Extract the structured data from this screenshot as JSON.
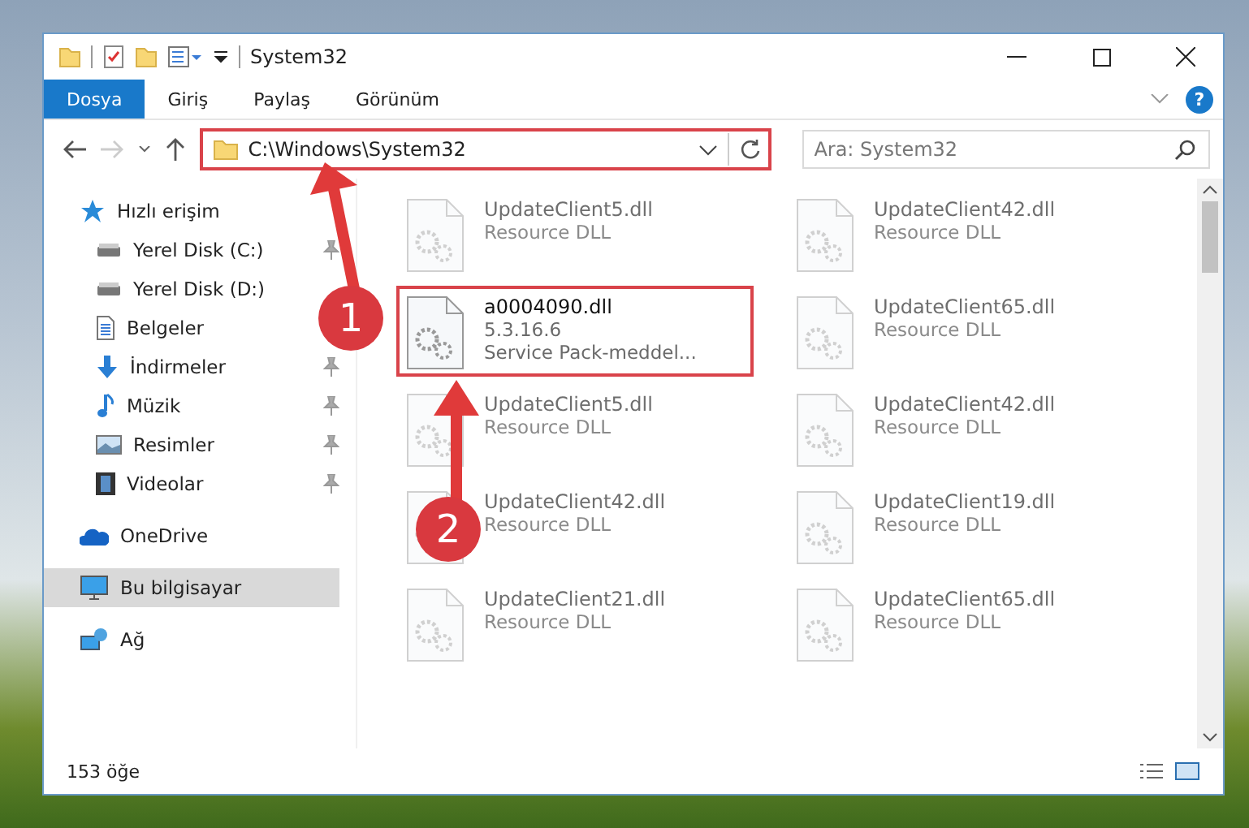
{
  "window": {
    "title": "System32"
  },
  "ribbon_tabs": [
    {
      "label": "Dosya",
      "selected": true
    },
    {
      "label": "Giriş",
      "selected": false
    },
    {
      "label": "Paylaş",
      "selected": false
    },
    {
      "label": "Görünüm",
      "selected": false
    }
  ],
  "help_button": {
    "label": "?"
  },
  "address_bar": {
    "path": "C:\\Windows\\System32",
    "highlighted": true
  },
  "search": {
    "placeholder": "Ara: System32"
  },
  "sidebar": {
    "items": [
      {
        "label": "Hızlı erişim",
        "kind": "star",
        "selected": false,
        "children": [
          {
            "label": "Yerel Disk (C:)",
            "kind": "drive",
            "pinned": true,
            "selected": false
          },
          {
            "label": "Yerel Disk (D:)",
            "kind": "drive",
            "pinned": false,
            "selected": false
          },
          {
            "label": "Belgeler",
            "kind": "document",
            "pinned": false,
            "selected": false
          },
          {
            "label": "İndirmeler",
            "kind": "download",
            "pinned": true,
            "selected": false
          },
          {
            "label": "Müzik",
            "kind": "music",
            "pinned": true,
            "selected": false
          },
          {
            "label": "Resimler",
            "kind": "picture",
            "pinned": true,
            "selected": false
          },
          {
            "label": "Videolar",
            "kind": "video",
            "pinned": true,
            "selected": false
          }
        ]
      },
      {
        "label": "OneDrive",
        "kind": "cloud",
        "selected": false
      },
      {
        "label": "Bu bilgisayar",
        "kind": "computer",
        "selected": true
      },
      {
        "label": "Ağ",
        "kind": "network",
        "selected": false
      }
    ]
  },
  "files": [
    {
      "name": "UpdateClient5.dll",
      "lines": [
        "Resource DLL"
      ],
      "faded": true,
      "highlighted": false
    },
    {
      "name": "UpdateClient42.dll",
      "lines": [
        "Resource DLL"
      ],
      "faded": true,
      "highlighted": false
    },
    {
      "name": "a0004090.dll",
      "lines": [
        "5.3.16.6",
        "Service Pack-meddel..."
      ],
      "faded": false,
      "highlighted": true
    },
    {
      "name": "UpdateClient65.dll",
      "lines": [
        "Resource DLL"
      ],
      "faded": true,
      "highlighted": false
    },
    {
      "name": "UpdateClient5.dll",
      "lines": [
        "Resource DLL"
      ],
      "faded": true,
      "highlighted": false
    },
    {
      "name": "UpdateClient42.dll",
      "lines": [
        "Resource DLL"
      ],
      "faded": true,
      "highlighted": false
    },
    {
      "name": "UpdateClient42.dll",
      "lines": [
        "Resource DLL"
      ],
      "faded": true,
      "highlighted": false
    },
    {
      "name": "UpdateClient19.dll",
      "lines": [
        "Resource DLL"
      ],
      "faded": true,
      "highlighted": false
    },
    {
      "name": "UpdateClient21.dll",
      "lines": [
        "Resource DLL"
      ],
      "faded": true,
      "highlighted": false
    },
    {
      "name": "UpdateClient65.dll",
      "lines": [
        "Resource DLL"
      ],
      "faded": true,
      "highlighted": false
    }
  ],
  "status_bar": {
    "item_count": "153 öğe"
  },
  "annotations": [
    {
      "number": "1"
    },
    {
      "number": "2"
    }
  ]
}
